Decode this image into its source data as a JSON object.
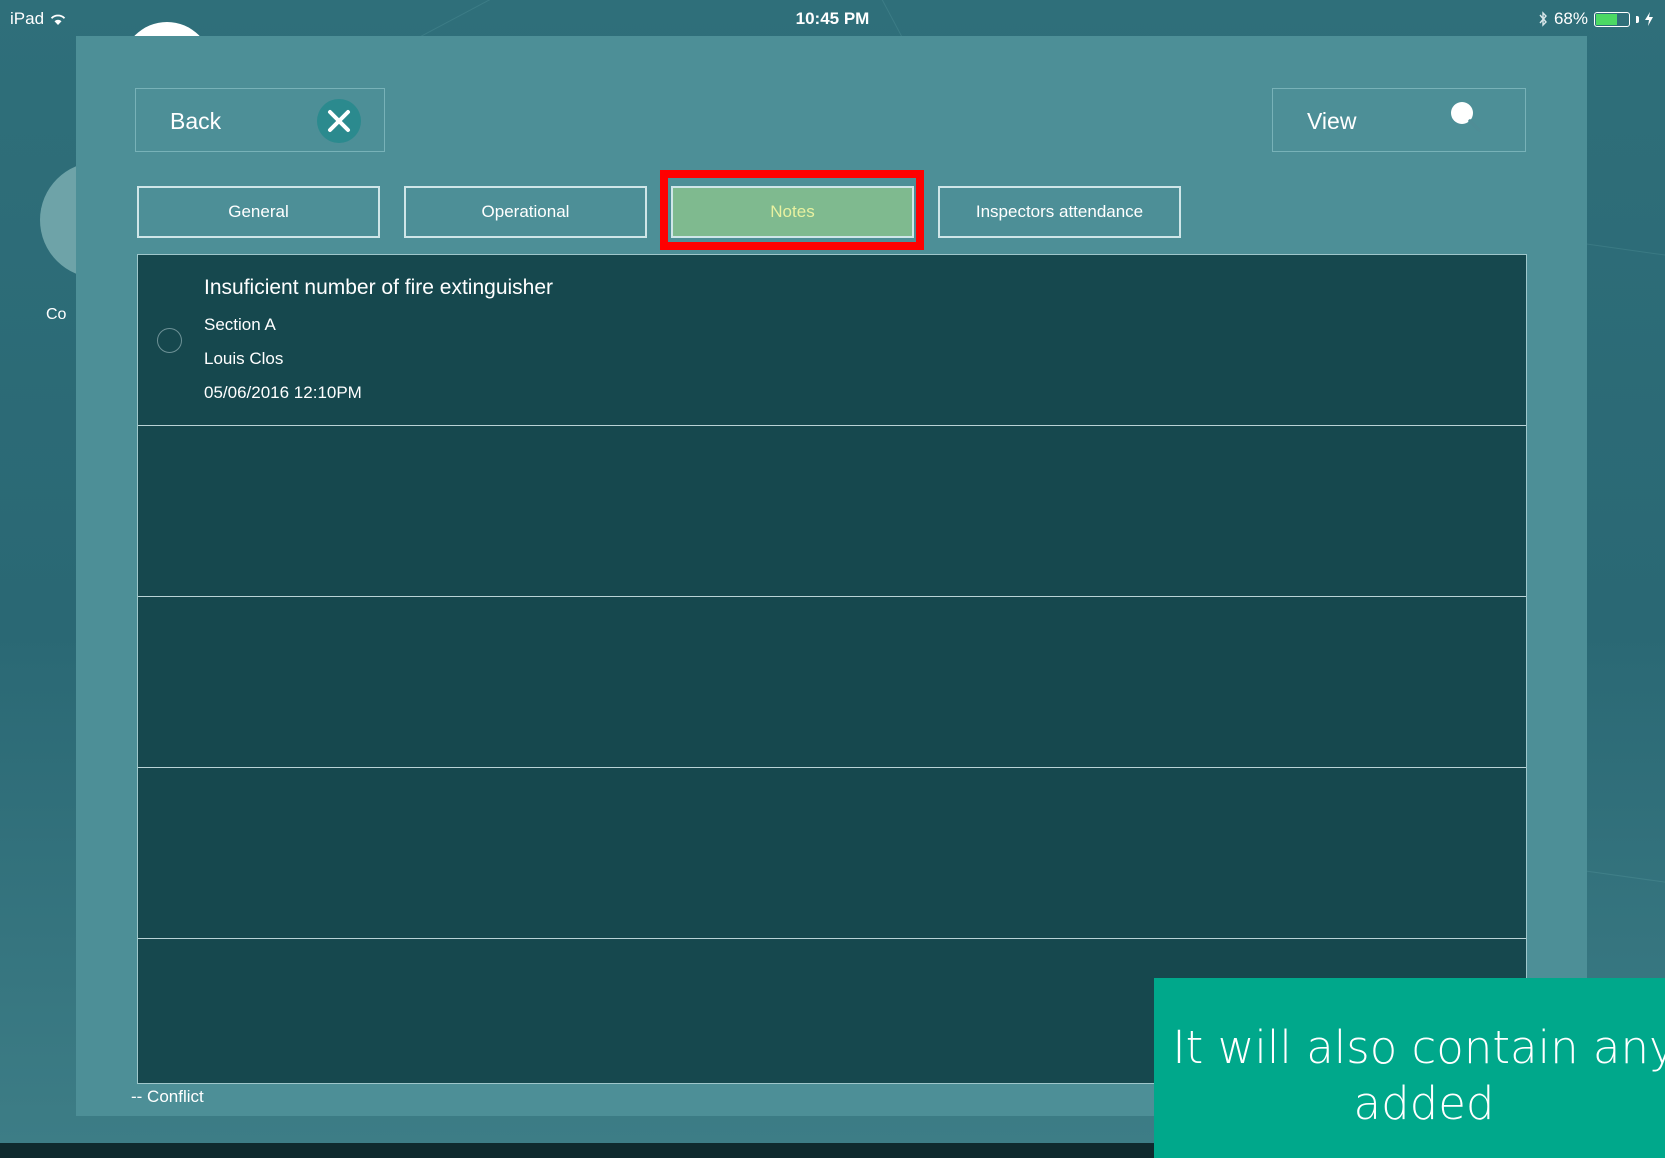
{
  "status_bar": {
    "device": "iPad",
    "time": "10:45 PM",
    "battery": "68%",
    "battery_level": 0.68,
    "icons": [
      "wifi-icon",
      "bluetooth-icon",
      "battery-icon",
      "charging-icon"
    ]
  },
  "background": {
    "partial_label": "Co"
  },
  "header": {
    "back_label": "Back",
    "view_label": "View",
    "icons": [
      "close-icon",
      "search-icon"
    ]
  },
  "tabs": [
    {
      "label": "General",
      "active": false
    },
    {
      "label": "Operational",
      "active": false
    },
    {
      "label": "Notes",
      "active": true
    },
    {
      "label": "Inspectors attendance",
      "active": false
    }
  ],
  "notes": [
    {
      "title": "Insuficient number of fire extinguisher",
      "section": "Section A",
      "author": "Louis Clos",
      "datetime": "05/06/2016 12:10PM"
    }
  ],
  "legend": {
    "conflict": "-- Conflict"
  },
  "caption": {
    "line1": "It will also contain any",
    "line2": "added"
  },
  "colors": {
    "active_tab": "#7fba8f",
    "highlight": "#ff0000",
    "list_bg": "#16484e",
    "caption_bg": "#00a88b"
  }
}
